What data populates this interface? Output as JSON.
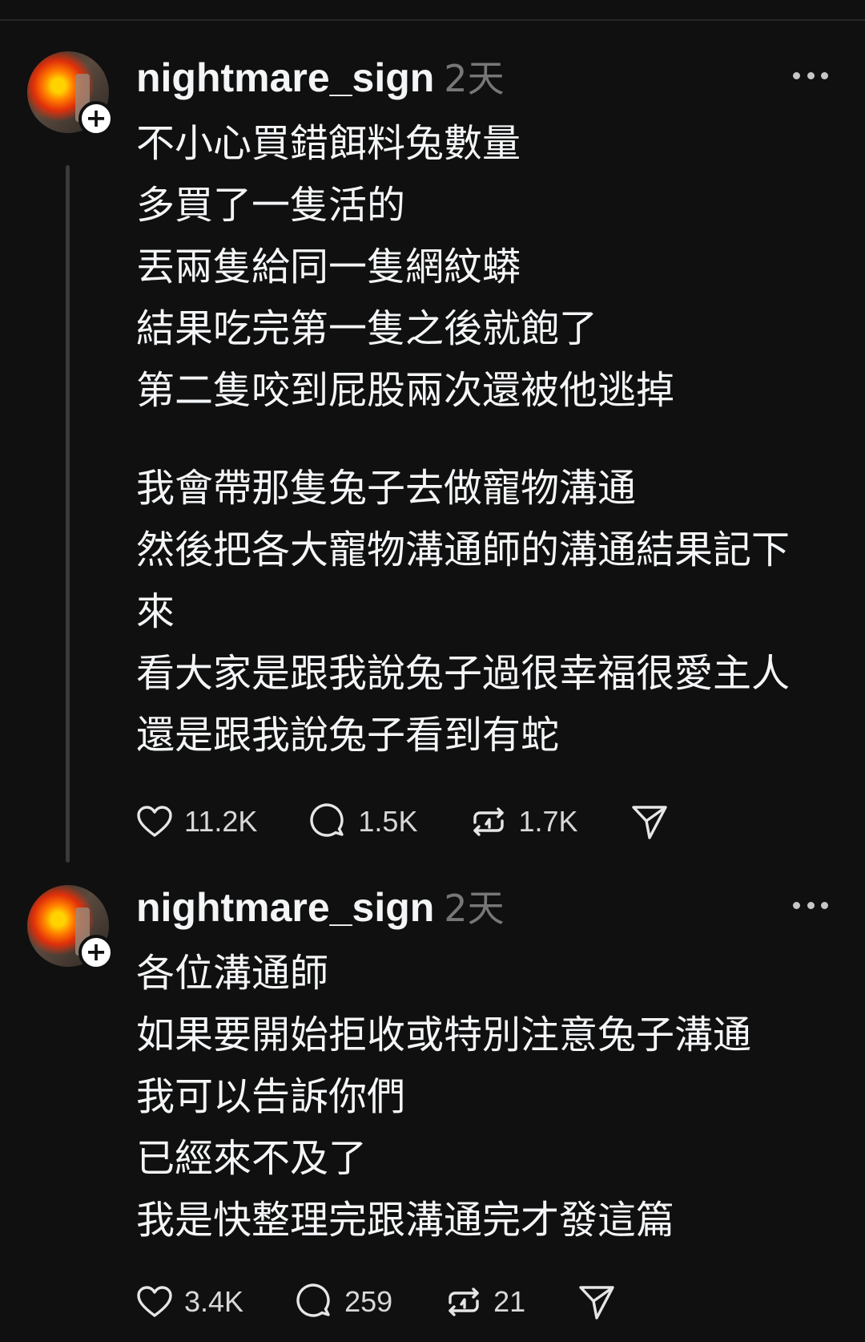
{
  "posts": [
    {
      "username": "nightmare_sign",
      "time_ago": "2天",
      "follow_symbol": "+",
      "paragraphs": [
        [
          "不小心買錯餌料兔數量",
          "多買了一隻活的",
          "丟兩隻給同一隻網紋蟒",
          "結果吃完第一隻之後就飽了",
          "第二隻咬到屁股兩次還被他逃掉"
        ],
        [
          "我會帶那隻兔子去做寵物溝通",
          "然後把各大寵物溝通師的溝通結果記下",
          "來",
          "看大家是跟我說兔子過很幸福很愛主人",
          "還是跟我說兔子看到有蛇"
        ]
      ],
      "likes": "11.2K",
      "replies": "1.5K",
      "reposts": "1.7K"
    },
    {
      "username": "nightmare_sign",
      "time_ago": "2天",
      "follow_symbol": "+",
      "paragraphs": [
        [
          "各位溝通師",
          "如果要開始拒收或特別注意兔子溝通",
          "我可以告訴你們",
          "已經來不及了",
          "我是快整理完跟溝通完才發這篇"
        ]
      ],
      "likes": "3.4K",
      "replies": "259",
      "reposts": "21"
    }
  ],
  "icons": {
    "like": "heart-icon",
    "reply": "comment-bubble-icon",
    "repost": "repost-icon",
    "share": "send-icon",
    "more": "more-dots-icon"
  },
  "colors": {
    "background": "#101010",
    "text": "#f3f5f7",
    "muted": "#777777",
    "thread_line": "#3a3a3a"
  }
}
